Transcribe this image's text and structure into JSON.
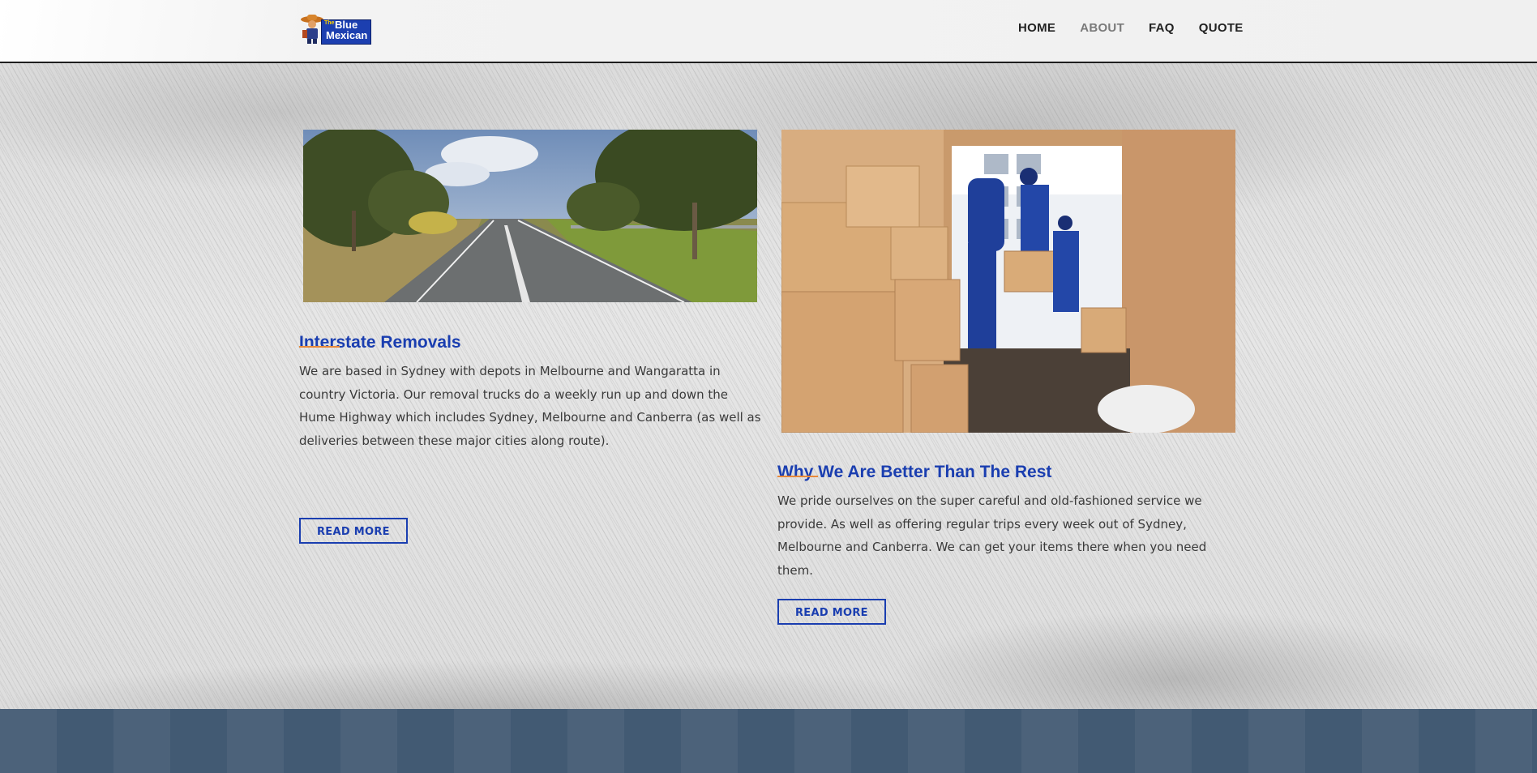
{
  "header": {
    "logo": {
      "line_small": "The",
      "line1": "Blue",
      "line2": "Mexican"
    },
    "nav": [
      {
        "label": "HOME",
        "active": false
      },
      {
        "label": "ABOUT",
        "active": true
      },
      {
        "label": "FAQ",
        "active": false
      },
      {
        "label": "QUOTE",
        "active": false
      }
    ]
  },
  "cards": [
    {
      "image": "country-highway-photo",
      "title": "Interstate Removals",
      "text": "We are based in Sydney with depots in Melbourne and Wangaratta in country Victoria. Our removal trucks do a weekly run up and down the Hume Highway which includes Sydney, Melbourne and Canberra (as well as deliveries between these major cities along route).",
      "button": "READ MORE"
    },
    {
      "image": "movers-loading-van-photo",
      "title": "Why We Are Better Than The Rest",
      "text": "We pride ourselves on the super careful and old-fashioned service we provide. As well as offering regular trips every week out of Sydney, Melbourne and Canberra. We can get your items there when you need them.",
      "button": "READ MORE"
    }
  ],
  "colors": {
    "accent": "#1a3eb0",
    "underline": "#e8893a",
    "footer": "#425a73"
  }
}
